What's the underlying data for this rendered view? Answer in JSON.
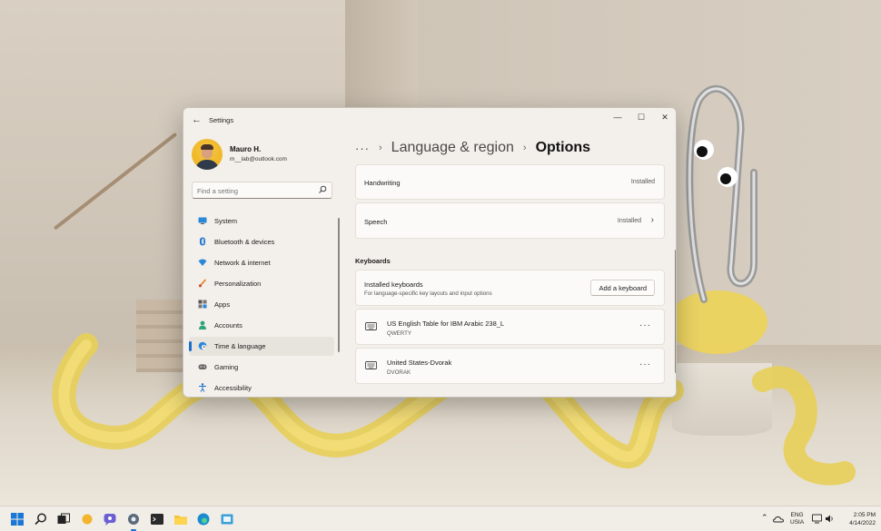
{
  "window": {
    "app_title": "Settings"
  },
  "user": {
    "name": "Mauro H.",
    "email": "m__lab@outlook.com"
  },
  "search": {
    "placeholder": "Find a setting"
  },
  "sidebar": {
    "items": [
      {
        "label": "System",
        "icon": "monitor-icon"
      },
      {
        "label": "Bluetooth & devices",
        "icon": "bluetooth-icon"
      },
      {
        "label": "Network & internet",
        "icon": "wifi-icon"
      },
      {
        "label": "Personalization",
        "icon": "brush-icon"
      },
      {
        "label": "Apps",
        "icon": "apps-icon"
      },
      {
        "label": "Accounts",
        "icon": "person-icon"
      },
      {
        "label": "Time & language",
        "icon": "globe-clock-icon",
        "active": true
      },
      {
        "label": "Gaming",
        "icon": "gamepad-icon"
      },
      {
        "label": "Accessibility",
        "icon": "accessibility-icon"
      }
    ]
  },
  "breadcrumb": {
    "more": "···",
    "parent": "Language & region",
    "current": "Options"
  },
  "features": [
    {
      "title": "Handwriting",
      "status": "Installed"
    },
    {
      "title": "Speech",
      "status": "Installed"
    }
  ],
  "keyboards": {
    "section_title": "Keyboards",
    "installed_title": "Installed keyboards",
    "installed_desc": "For language-specific key layouts and input options",
    "add_button": "Add a keyboard",
    "list": [
      {
        "name": "US English Table for IBM Arabic 238_L",
        "layout": "QWERTY"
      },
      {
        "name": "United States-Dvorak",
        "layout": "DVORAK"
      }
    ],
    "more": "···"
  },
  "taskbar": {
    "lang_top": "ENG",
    "lang_bottom": "US\nIA",
    "lang_line1": "ENG",
    "lang_line2": "USIA",
    "time": "2:05 PM",
    "date": "4/14/2022"
  },
  "colors": {
    "accent": "#1a6fc9",
    "window_bg": "#f3f0eb",
    "card_bg": "#fbfaf8"
  }
}
